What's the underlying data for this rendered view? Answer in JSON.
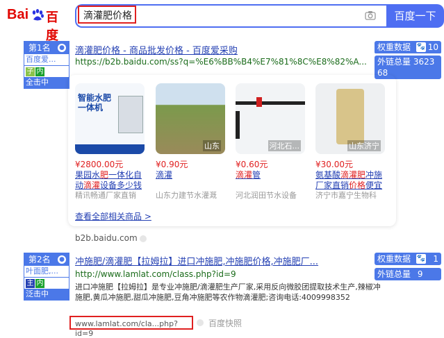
{
  "header": {
    "logo_bai": "Bai",
    "logo_du": "百度",
    "query": "滴灌肥价格",
    "search_button": "百度一下"
  },
  "results": [
    {
      "rank_label": "第1名",
      "site_short": "百度爱...",
      "tag1": "子",
      "tag2": "内",
      "tag3": "全击中",
      "title_hl": "滴灌肥价格",
      "title_rest": " - 商品批发价格 - 百度爱采购",
      "url": "https://b2b.baidu.com/ss?q=%E6%BB%B4%E7%81%8C%E8%82%A...",
      "weight_label": "权重数据",
      "weight_value": "10",
      "links_label": "外链总量",
      "links_value": "362368",
      "products": [
        {
          "price": "¥2800.00元",
          "name_parts": [
            "果园水",
            "肥",
            "一体化自动",
            "滴灌",
            "设备多少钱"
          ],
          "shop": "精讯畅通厂家直销",
          "loc": "",
          "img_text": "智能水肥一体机"
        },
        {
          "price": "¥0.90元",
          "name_parts": [
            "",
            "滴灌",
            ""
          ],
          "shop": "山东力建节水灌溉",
          "loc": "山东"
        },
        {
          "price": "¥0.60元",
          "name_parts": [
            "",
            "滴灌",
            "管"
          ],
          "shop": "河北润田节水设备",
          "loc": "河北石..."
        },
        {
          "price": "¥30.00元",
          "name_parts": [
            "氨基酸",
            "滴灌肥",
            "冲施厂家直销",
            "价格",
            "便宜"
          ],
          "shop": "济宁市嘉宁生物科",
          "loc": "山东济宁"
        }
      ],
      "more_link": "查看全部相关商品 >",
      "footer_url": "b2b.baidu.com"
    },
    {
      "rank_label": "第2名",
      "site_short": "叶面肥,...",
      "tag1": "主",
      "tag2": "内",
      "tag3": "泛击中",
      "title": "冲施肥/滴灌肥【拉姆拉】进口冲施肥,冲施肥价格,冲施肥厂...",
      "url": "http://www.lamlat.com/class.php?id=9",
      "snippet": "进口冲施肥【拉姆拉】是专业冲施肥/滴灌肥生产厂家,采用反向微胶团提取技术生产,辣椒冲施肥,黄瓜冲施肥,甜瓜冲施肥,豆角冲施肥等农作物滴灌肥;咨询电话:4009998352",
      "weight_label": "权重数据",
      "weight_value": "1",
      "links_label": "外链总量",
      "links_value": "9",
      "footer_url": "www.lamlat.com/cla...php?id=9",
      "snapshot": "百度快照"
    }
  ]
}
